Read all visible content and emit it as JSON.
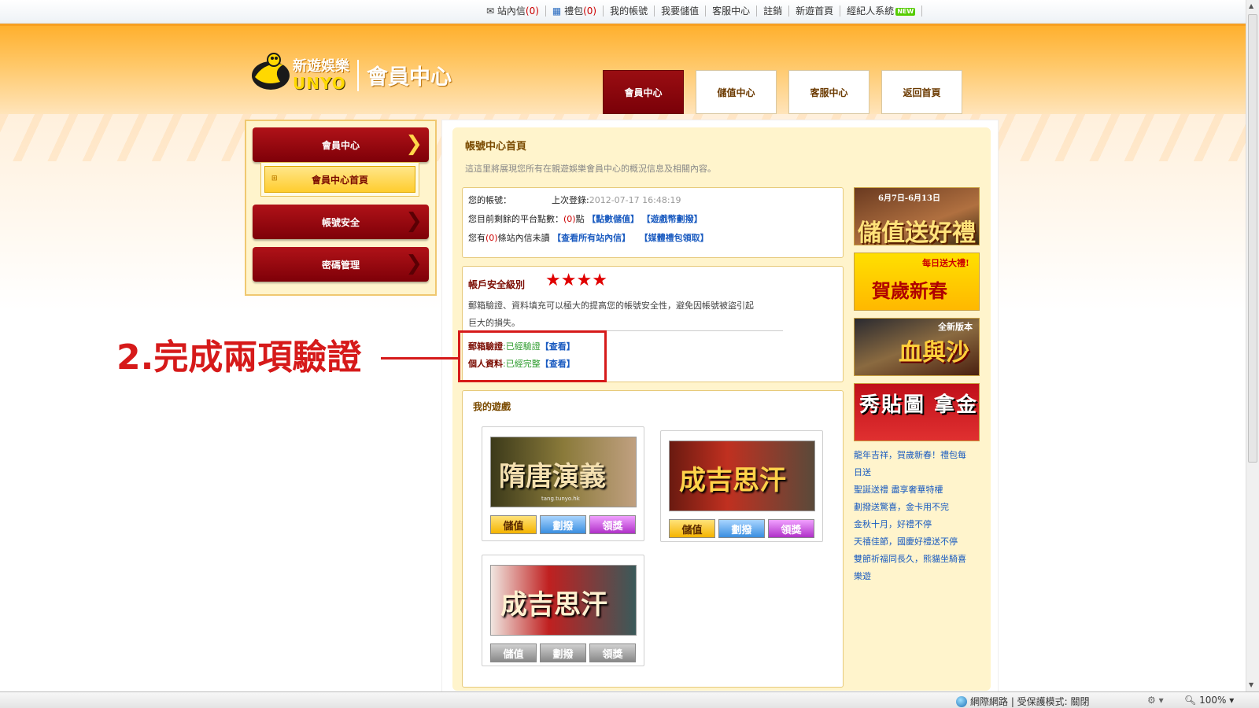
{
  "topnav": {
    "inbox_label": "站內信",
    "inbox_count": "(0)",
    "gift_label": "禮包",
    "gift_count": "(0)",
    "my_account": "我的帳號",
    "recharge": "我要儲值",
    "support": "客服中心",
    "logout": "註銷",
    "new_home": "新遊首頁",
    "agent": "經紀人系統",
    "agent_badge": "NEW"
  },
  "header": {
    "brand_cn": "新遊娛樂",
    "brand_en": "UNYO",
    "section_title": "會員中心",
    "tabs": [
      {
        "label": "會員中心",
        "active": true
      },
      {
        "label": "儲值中心",
        "active": false
      },
      {
        "label": "客服中心",
        "active": false
      },
      {
        "label": "返回首頁",
        "active": false
      }
    ]
  },
  "sidebar": {
    "items": [
      {
        "label": "會員中心"
      },
      {
        "label": "帳號安全"
      },
      {
        "label": "密碼管理"
      }
    ],
    "sub_item": "會員中心首頁"
  },
  "page": {
    "title": "帳號中心首頁",
    "description": "這這里將展現您所有在親遊娛樂會員中心的概況信息及相關內容。"
  },
  "account": {
    "account_label": "您的帳號：",
    "last_login_label": "上次登錄:",
    "last_login_value": "2012-07-17 16:48:19",
    "points_label": "您目前剩餘的平台點數：",
    "points_value": "(0)",
    "points_unit": "點",
    "link_recharge": "【點數儲值】",
    "link_transfer": "【遊戲幣劃撥】",
    "msg_prefix": "您有",
    "msg_count": "(0)",
    "msg_suffix": "條站內信未讀",
    "link_all_msgs": "【查看所有站內信】",
    "link_gift": "【媒體禮包領取】"
  },
  "security": {
    "title": "帳戶安全級別",
    "stars": 4,
    "desc_line1": "郵箱驗證、資料填充可以極大的提高您的帳號安全性，避免因帳號被盜引起",
    "desc_line2": "巨大的損失。",
    "email_label": "郵箱驗證",
    "email_status": ":已經驗證",
    "email_link": "【查看】",
    "profile_label": "個人資料",
    "profile_status": ":已經完整",
    "profile_link": "【查看】"
  },
  "annotation": {
    "text": "2.完成兩項驗證",
    "color": "#d61a1a"
  },
  "games": {
    "title": "我的遊戲",
    "list": [
      {
        "name": "隋唐演義",
        "caption": "tang.tunyo.hk",
        "buttons": [
          "儲值",
          "劃撥",
          "領獎"
        ],
        "enabled": true
      },
      {
        "name": "成吉思汗",
        "buttons": [
          "儲值",
          "劃撥",
          "領獎"
        ],
        "enabled": true
      },
      {
        "name": "成吉思汗",
        "buttons": [
          "儲值",
          "劃撥",
          "領獎"
        ],
        "enabled": false
      }
    ]
  },
  "banners": {
    "list": [
      {
        "text": "儲值送好禮",
        "sub": "6月7日-6月13日"
      },
      {
        "text": "賀歲新春",
        "sub": "每日送大禮!"
      },
      {
        "text": "血與沙",
        "sub": "全新版本"
      },
      {
        "text": "秀貼圖 拿金卡",
        "sub": ""
      }
    ]
  },
  "news": [
    "龍年吉祥，賀歲新春！禮包每",
    "日送",
    "聖誕送禮 盡享奢華特權",
    "劃撥送驚喜，金卡用不完",
    "金秋十月，好禮不停",
    "天禧佳節，國慶好禮送不停",
    "雙節祈福同長久，熊貓坐騎喜",
    "樂遊"
  ],
  "statusbar": {
    "zone": "網際網路 | 受保護模式: 關閉",
    "zoom": "100%"
  }
}
